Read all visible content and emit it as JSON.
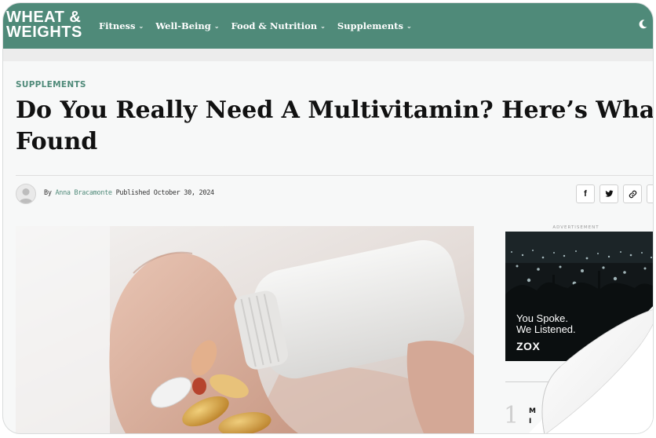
{
  "header": {
    "logo_line1": "WHEAT &",
    "logo_line2": "WEIGHTS",
    "nav": [
      {
        "label": "Fitness"
      },
      {
        "label": "Well-Being"
      },
      {
        "label": "Food & Nutrition"
      },
      {
        "label": "Supplements"
      }
    ],
    "chevron": "⌄"
  },
  "article": {
    "category": "SUPPLEMENTS",
    "title_line1": "Do You Really Need A Multivitamin? Here’s What We",
    "title_line2": "Found",
    "by": "By",
    "author": "Anna Bracamonte",
    "published_label": "Published",
    "published_date": "October 30, 2024",
    "share": [
      {
        "icon": "facebook-icon",
        "glyph": "f"
      },
      {
        "icon": "twitter-icon",
        "glyph": "🐦"
      },
      {
        "icon": "link-icon",
        "glyph": "🔗"
      },
      {
        "icon": "more-icon",
        "glyph": "···"
      }
    ]
  },
  "sidebar": {
    "ad_label": "ADVERTISEMENT",
    "ad_line1": "You Spoke.",
    "ad_line2": "We Listened.",
    "ad_brand": "ZOX",
    "trending_number": "1",
    "trending_text_line1": "M",
    "trending_text_line2": "I"
  },
  "colors": {
    "brand": "#4f8a79",
    "background": "#f7f8f8",
    "title": "#111111"
  }
}
